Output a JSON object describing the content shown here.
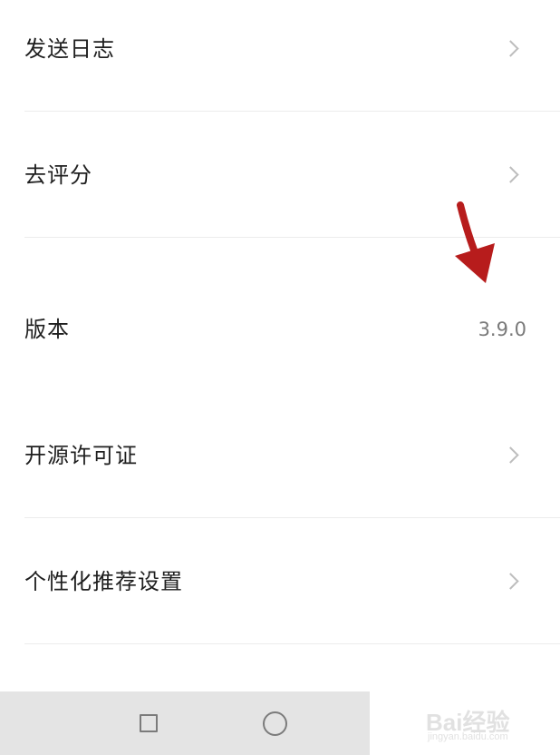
{
  "settings": {
    "items": [
      {
        "label": "发送日志",
        "has_chevron": true
      },
      {
        "label": "去评分",
        "has_chevron": true
      },
      {
        "label": "版本",
        "value": "3.9.0"
      },
      {
        "label": "开源许可证",
        "has_chevron": true
      },
      {
        "label": "个性化推荐设置",
        "has_chevron": true
      }
    ]
  },
  "annotation": {
    "arrow_color": "#b71c1c",
    "arrow_icon": "red-down-arrow-icon"
  },
  "navigation_bar": {
    "recent_apps_icon": "square-icon",
    "home_icon": "circle-icon"
  },
  "watermark": {
    "brand": "Bai经验",
    "sub": "jingyan.baidu.com"
  }
}
